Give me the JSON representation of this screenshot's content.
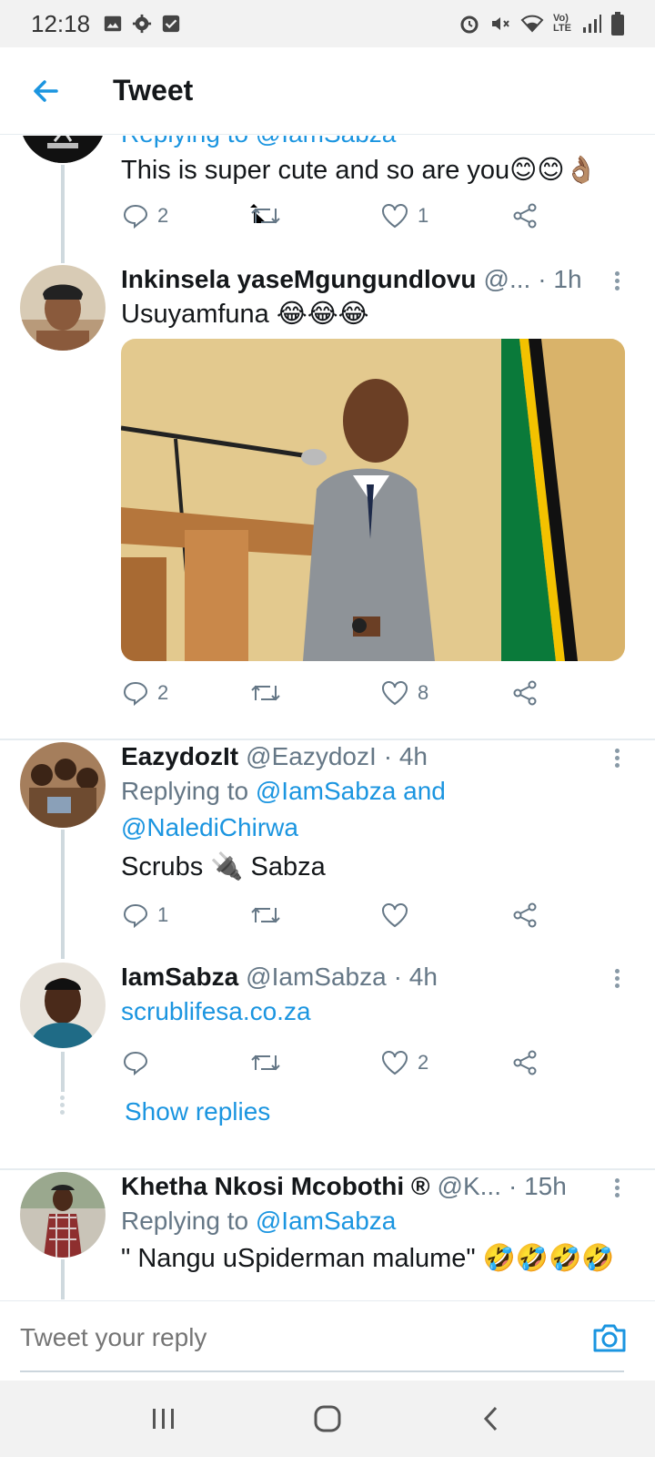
{
  "status_bar": {
    "time": "12:18",
    "left_icons": [
      "image-icon",
      "gear-icon",
      "checkbox-icon"
    ],
    "right_icons": [
      "alarm-icon",
      "mute-icon",
      "wifi-icon",
      "volte-icon",
      "signal-icon",
      "battery-icon"
    ],
    "volte_text": "Vo) LTE"
  },
  "header": {
    "title": "Tweet",
    "back_icon": "back-arrow-icon"
  },
  "tweets": [
    {
      "reply_to_partial": "Replying to @IamSabza",
      "text": "This is super cute and so are you😊😊👌🏽",
      "replies": "2",
      "retweets": "",
      "likes": "1"
    },
    {
      "name": "Inkinsela yaseMgungundlovu",
      "handle": "@...",
      "time": "· 1h",
      "text": "Usuyamfuna 😂😂😂",
      "image_alt": "man in grey suit speaking at wooden podium with flag",
      "replies": "2",
      "retweets": "",
      "likes": "8"
    },
    {
      "name": "EazydozIt",
      "handle": "@EazydozI",
      "time": "· 4h",
      "reply_prefix": "Replying to ",
      "reply_user1": "@IamSabza and",
      "reply_user2": "@NalediChirwa",
      "text": "Scrubs 🔌 Sabza",
      "replies": "1",
      "retweets": "",
      "likes": ""
    },
    {
      "name": "IamSabza",
      "handle": "@IamSabza",
      "time": "· 4h",
      "text": "scrublifesa.co.za",
      "replies": "",
      "retweets": "",
      "likes": "2",
      "show_replies": "Show replies"
    },
    {
      "name": "Khetha Nkosi Mcobothi ®",
      "handle": "@K...",
      "time": "· 15h",
      "reply_prefix": "Replying to ",
      "reply_user1": "@IamSabza",
      "text": "\" Nangu uSpiderman malume\" 🤣🤣🤣🤣"
    }
  ],
  "reply_bar": {
    "placeholder": "Tweet your reply",
    "camera_icon": "camera-icon"
  },
  "nav_bar": {
    "icons": [
      "recents-icon",
      "home-icon",
      "back-icon"
    ]
  },
  "colors": {
    "accent": "#1b95e0",
    "text": "#14171a",
    "muted": "#657786",
    "divider": "#e6ecf0",
    "system_bar": "#f2f2f2"
  }
}
